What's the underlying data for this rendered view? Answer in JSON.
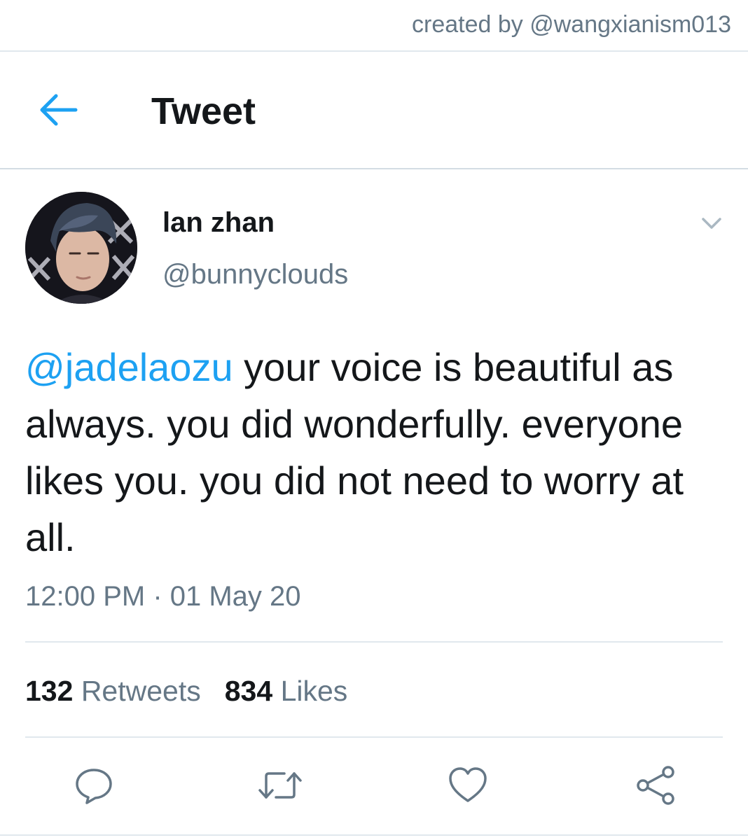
{
  "credit": "created by @wangxianism013",
  "header": {
    "title": "Tweet",
    "back_icon": "arrow-left-icon"
  },
  "colors": {
    "accent": "#1da1f2",
    "text": "#14171a",
    "muted": "#657786",
    "divider": "#e1e8ed"
  },
  "tweet": {
    "author": {
      "name": "lan zhan",
      "handle": "@bunnyclouds"
    },
    "mention": "@jadelaozu",
    "text": " your voice is beautiful as always. you did wonderfully. everyone likes you. you did not need to worry at all.",
    "timestamp": "12:00 PM · 01 May 20"
  },
  "stats": {
    "retweets_count": "132",
    "retweets_label": "Retweets",
    "likes_count": "834",
    "likes_label": "Likes"
  },
  "actions": {
    "icons": [
      "reply-icon",
      "retweet-icon",
      "like-icon",
      "share-icon"
    ]
  }
}
